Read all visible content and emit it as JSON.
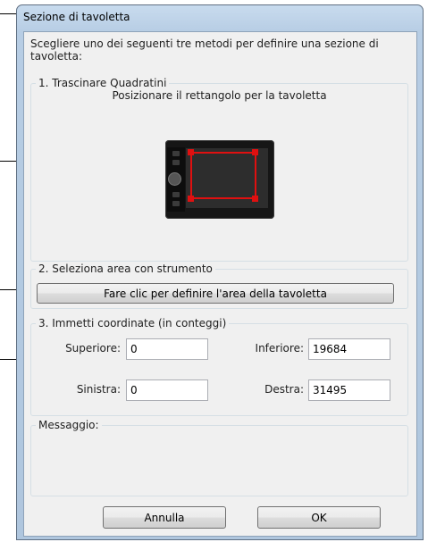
{
  "window": {
    "title": "Sezione di tavoletta"
  },
  "intro": "Scegliere uno dei seguenti tre metodi per definire una sezione di tavoletta:",
  "section1": {
    "legend": "1. Trascinare Quadratini",
    "caption": "Posizionare il rettangolo per la tavoletta"
  },
  "section2": {
    "legend": "2. Seleziona area con strumento",
    "button_label": "Fare clic per definire l'area della tavoletta"
  },
  "section3": {
    "legend": "3. Immetti coordinate (in conteggi)",
    "top_label": "Superiore:",
    "top_value": "0",
    "bottom_label": "Inferiore:",
    "bottom_value": "19684",
    "left_label": "Sinistra:",
    "left_value": "0",
    "right_label": "Destra:",
    "right_value": "31495"
  },
  "message": {
    "legend": "Messaggio:",
    "text": ""
  },
  "buttons": {
    "cancel_label": "Annulla",
    "ok_label": "OK"
  },
  "colors": {
    "selection": "#e01010",
    "tablet_body": "#161616"
  }
}
